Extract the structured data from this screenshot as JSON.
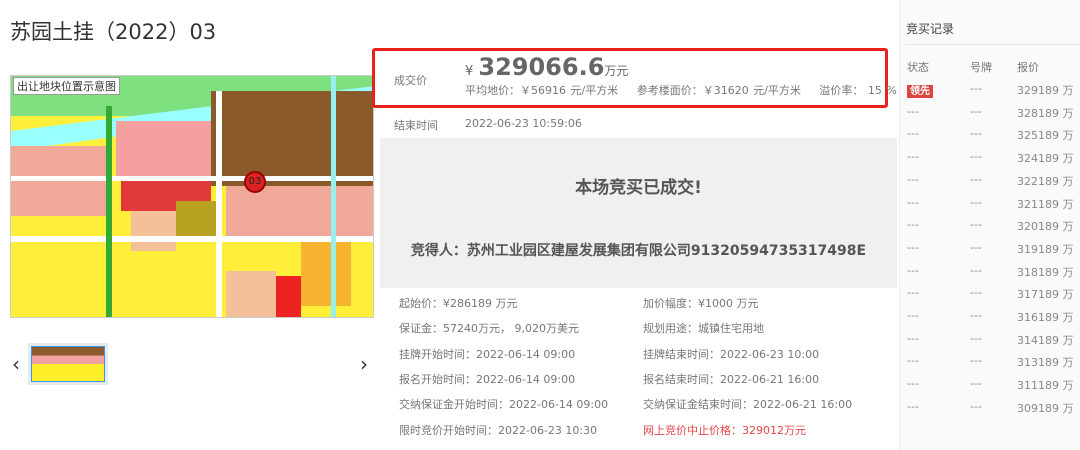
{
  "title": "苏园土挂（2022）03",
  "map": {
    "label": "出让地块位置示意图",
    "marker": "03"
  },
  "nav": {
    "prev": "‹",
    "next": "›"
  },
  "price": {
    "label": "成交价",
    "currency": "¥",
    "value": "329066.6",
    "unit": "万元",
    "avg": "平均地价：￥56916 元/平方米",
    "floor": "参考楼面价：￥31620 元/平方米",
    "premium": "溢价率： 15 %"
  },
  "end": {
    "label": "结束时间",
    "value": "2022-06-23 10:59:06"
  },
  "result": {
    "status": "本场竞买已成交!",
    "winner": "竞得人：苏州工业园区建屋发展集团有限公司91320594735317498E"
  },
  "details": [
    [
      "起始价：¥286189 万元",
      "加价幅度：¥1000 万元"
    ],
    [
      "保证金：57240万元， 9,020万美元",
      "规划用途：城镇住宅用地"
    ],
    [
      "挂牌开始时间：2022-06-14 09:00",
      "挂牌结束时间：2022-06-23 10:00"
    ],
    [
      "报名开始时间：2022-06-14 09:00",
      "报名结束时间：2022-06-21 16:00"
    ],
    [
      "交纳保证金开始时间：2022-06-14 09:00",
      "交纳保证金结束时间：2022-06-21 16:00"
    ],
    [
      "限时竞价开始时间：2022-06-23 10:30",
      "网上竞价中止价格：329012万元"
    ]
  ],
  "bids": {
    "title": "竞买记录",
    "headers": [
      "状态",
      "号牌",
      "报价"
    ],
    "rows": [
      [
        "领先",
        "---",
        "329189 万"
      ],
      [
        "---",
        "---",
        "328189 万"
      ],
      [
        "---",
        "---",
        "325189 万"
      ],
      [
        "---",
        "---",
        "324189 万"
      ],
      [
        "---",
        "---",
        "322189 万"
      ],
      [
        "---",
        "---",
        "321189 万"
      ],
      [
        "---",
        "---",
        "320189 万"
      ],
      [
        "---",
        "---",
        "319189 万"
      ],
      [
        "---",
        "---",
        "318189 万"
      ],
      [
        "---",
        "---",
        "317189 万"
      ],
      [
        "---",
        "---",
        "316189 万"
      ],
      [
        "---",
        "---",
        "314189 万"
      ],
      [
        "---",
        "---",
        "313189 万"
      ],
      [
        "---",
        "---",
        "311189 万"
      ],
      [
        "---",
        "---",
        "309189 万"
      ]
    ]
  },
  "colors": {
    "accent": "#e8221b",
    "lead": "#d9473f"
  }
}
